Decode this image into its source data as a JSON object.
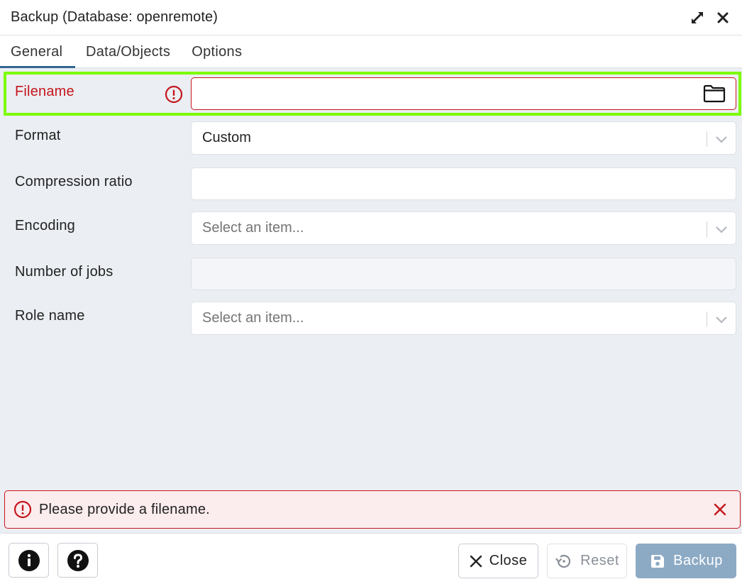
{
  "dialog": {
    "title": "Backup (Database: openremote)"
  },
  "tabs": [
    {
      "label": "General",
      "active": true
    },
    {
      "label": "Data/Objects",
      "active": false
    },
    {
      "label": "Options",
      "active": false
    }
  ],
  "form": {
    "filename": {
      "label": "Filename",
      "value": "",
      "icon": "folder-icon",
      "error": true
    },
    "format": {
      "label": "Format",
      "value": "Custom"
    },
    "compression_ratio": {
      "label": "Compression ratio",
      "value": ""
    },
    "encoding": {
      "label": "Encoding",
      "placeholder": "Select an item..."
    },
    "number_of_jobs": {
      "label": "Number of jobs",
      "value": "",
      "disabled": true
    },
    "role_name": {
      "label": "Role name",
      "placeholder": "Select an item..."
    }
  },
  "error_banner": {
    "message": "Please provide a filename."
  },
  "footer": {
    "info_icon": "info-icon",
    "help_icon": "help-icon",
    "close_label": "Close",
    "reset_label": "Reset",
    "backup_label": "Backup"
  },
  "colors": {
    "error": "#c4161c",
    "highlight": "#7cfc00",
    "primary_disabled": "#8daac5",
    "active_tab": "#326690",
    "content_bg": "#ebeef3"
  }
}
